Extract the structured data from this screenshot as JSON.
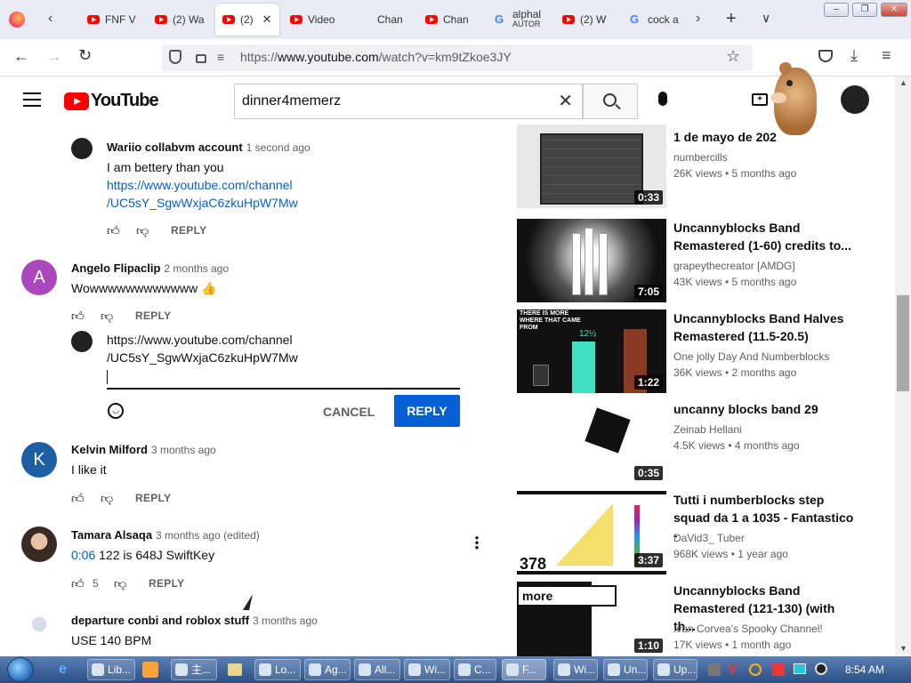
{
  "browser": {
    "tabs": [
      {
        "label": "FNF V",
        "icon": "youtube"
      },
      {
        "label": "(2) Wa",
        "icon": "youtube"
      },
      {
        "label": "(2)",
        "icon": "youtube",
        "active": true
      },
      {
        "label": "Video",
        "icon": "youtube"
      },
      {
        "label": "Chan",
        "icon": "none"
      },
      {
        "label": "Chan",
        "icon": "youtube"
      },
      {
        "label": "alphal",
        "sub": "AUTOR",
        "icon": "google"
      },
      {
        "label": "(2) W",
        "icon": "youtube"
      },
      {
        "label": "cock a",
        "icon": "google"
      }
    ],
    "url_prefix": "https://",
    "url_domain": "www.youtube.com",
    "url_path": "/watch?v=km9tZkoe3JY"
  },
  "youtube": {
    "logo_text": "YouTube",
    "search_value": "dinner4memerz"
  },
  "comments": [
    {
      "name": "Wariio collabvm account",
      "time": "1 second ago",
      "lines": [
        "I am bettery than you"
      ],
      "links": [
        "https://www.youtube.com/channel",
        "/UC5sY_SgwWxjaC6zkuHpW7Mw"
      ],
      "reply": "REPLY"
    },
    {
      "name": "Angelo Flipaclip",
      "time": "2 months ago",
      "avatar_letter": "A",
      "text": "Wowwwwwwwwwwww",
      "emoji": "👍",
      "reply": "REPLY"
    },
    {
      "name": "Kelvin Milford",
      "time": "3 months ago",
      "avatar_letter": "K",
      "text": "I like it",
      "reply": "REPLY"
    },
    {
      "name": "Tamara Alsaqa",
      "time": "3 months ago (edited)",
      "timestamp_link": "0:06",
      "text": " 122 is 648J SwiftKey",
      "likes": "5",
      "reply": "REPLY"
    },
    {
      "name": "departure conbi and roblox stuff",
      "time": "3 months ago",
      "text": "USE 140 BPM"
    }
  ],
  "reply_box": {
    "lines": [
      "https://www.youtube.com/channel",
      "/UC5sY_SgwWxjaC6zkuHpW7Mw"
    ],
    "cancel_label": "CANCEL",
    "reply_label": "REPLY"
  },
  "videos": [
    {
      "title": "1 de mayo de 202",
      "channel": "numbercills",
      "meta": "26K views • 5 months ago",
      "duration": "0:33"
    },
    {
      "title": "Uncannyblocks Band Remastered (1-60) credits to...",
      "channel": "grapeythecreator [AMDG]",
      "meta": "43K views • 5 months ago",
      "duration": "7:05"
    },
    {
      "title": "Uncannyblocks Band Halves Remastered (11.5-20.5)",
      "channel": "One jolly Day And Numberblocks",
      "meta": "36K views • 2 months ago",
      "duration": "1:22",
      "thumb_text": "THERE IS MORE WHERE THAT CAME FROM",
      "thumb_num": "12½"
    },
    {
      "title": "uncanny blocks band 29",
      "channel": "Zeinab Hellani",
      "meta": "4.5K views • 4 months ago",
      "duration": "0:35"
    },
    {
      "title": "Tutti i numberblocks step squad da 1 a 1035 - Fantastico -",
      "channel": "DaVid3_ Tuber",
      "meta": "968K views • 1 year ago",
      "duration": "3:37",
      "thumb_num": "378"
    },
    {
      "title": "Uncannyblocks Band Remastered (121-130) (with th...",
      "channel": "Ivan Corvea's Spooky Channel!",
      "meta": "17K views • 1 month ago",
      "duration": "1:10",
      "thumb_text": "more"
    }
  ],
  "taskbar": {
    "items": [
      "Lib...",
      "主...",
      "Lo...",
      "Ag...",
      "All...",
      "Wi...",
      "C...",
      "F...",
      "Wi...",
      "Un...",
      "Up..."
    ],
    "clock": "8:54 AM"
  },
  "colors": {
    "youtube_red": "#ff0000",
    "link_blue": "#065fd4",
    "reply_blue": "#065fd4"
  }
}
